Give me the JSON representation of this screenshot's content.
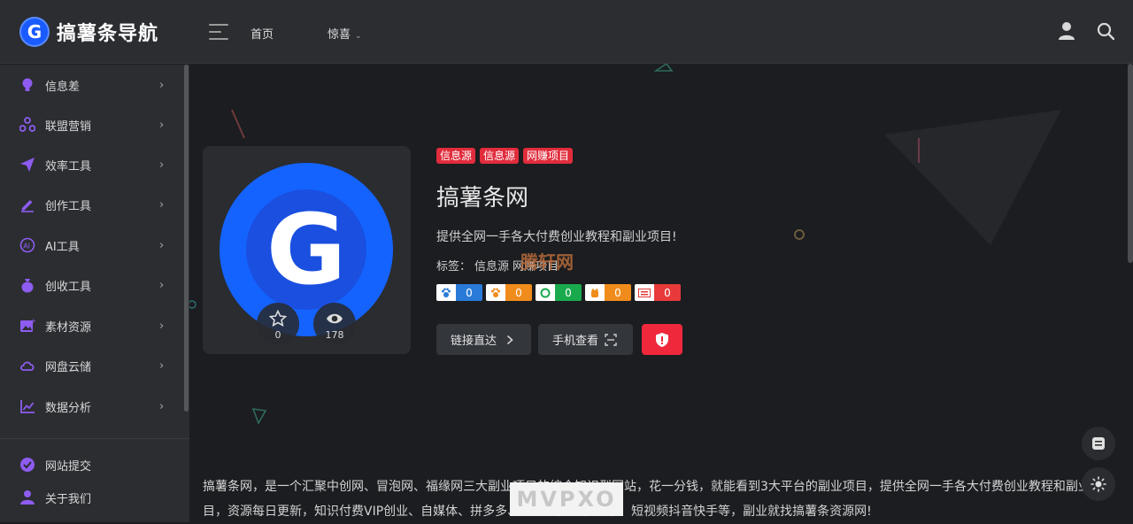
{
  "header": {
    "logo_letter": "G",
    "site_name": "搞薯条导航",
    "nav": [
      {
        "label": "首页"
      },
      {
        "label": "惊喜"
      }
    ],
    "icons": [
      "menu-icon",
      "user-icon",
      "search-icon"
    ]
  },
  "sidebar": {
    "items": [
      {
        "label": "信息差",
        "icon": "lightbulb-icon"
      },
      {
        "label": "联盟营销",
        "icon": "network-icon"
      },
      {
        "label": "效率工具",
        "icon": "paper-plane-icon"
      },
      {
        "label": "创作工具",
        "icon": "pencil-icon"
      },
      {
        "label": "AI工具",
        "icon": "ai-icon"
      },
      {
        "label": "创收工具",
        "icon": "money-bag-icon"
      },
      {
        "label": "素材资源",
        "icon": "image-icon"
      },
      {
        "label": "网盘云储",
        "icon": "cloud-icon"
      },
      {
        "label": "数据分析",
        "icon": "chart-icon"
      }
    ],
    "bottom_items": [
      {
        "label": "网站提交",
        "icon": "check-circle-icon"
      },
      {
        "label": "关于我们",
        "icon": "person-icon"
      }
    ]
  },
  "site": {
    "logo_letter": "G",
    "favorites": "0",
    "views": "178",
    "tags": [
      "信息源",
      "信息源",
      "网赚项目"
    ],
    "title": "搞薯条网",
    "description": "提供全网一手各大付费创业教程和副业项目!",
    "label_prefix": "标签：",
    "labels": [
      "信息源",
      "网赚项目"
    ],
    "watermark": "腾轩网",
    "badges": [
      {
        "icon": "baidu-icon",
        "value": "0",
        "color": "#2a7bd8"
      },
      {
        "icon": "baidu-mobile-icon",
        "value": "0",
        "color": "#f08c1c"
      },
      {
        "icon": "360-icon",
        "value": "0",
        "color": "#1aaa4e"
      },
      {
        "icon": "sogou-icon",
        "value": "0",
        "color": "#f08c1c"
      },
      {
        "icon": "toutiao-icon",
        "value": "0",
        "color": "#e83a3a"
      }
    ],
    "buttons": {
      "link": "链接直达",
      "phone": "手机查看"
    }
  },
  "article": {
    "text": "搞薯条网，是一个汇聚中创网、冒泡网、福缘网三大副业项目的综合知识型网站，花一分钱，就能看到3大平台的副业项目，提供全网一手各大付费创业教程和副业项目，资源每日更新，知识付费VIP创业、自媒体、拼多多、淘系电商、小红书、短视频抖音快手等，副业就找搞薯条资源网!",
    "overlay_mark": "MVPXO"
  },
  "colors": {
    "accent_red": "#f0283c",
    "tag_red": "#e12c3c",
    "brand_blue": "#1463ff",
    "icon_purple": "#8e5cf0"
  }
}
